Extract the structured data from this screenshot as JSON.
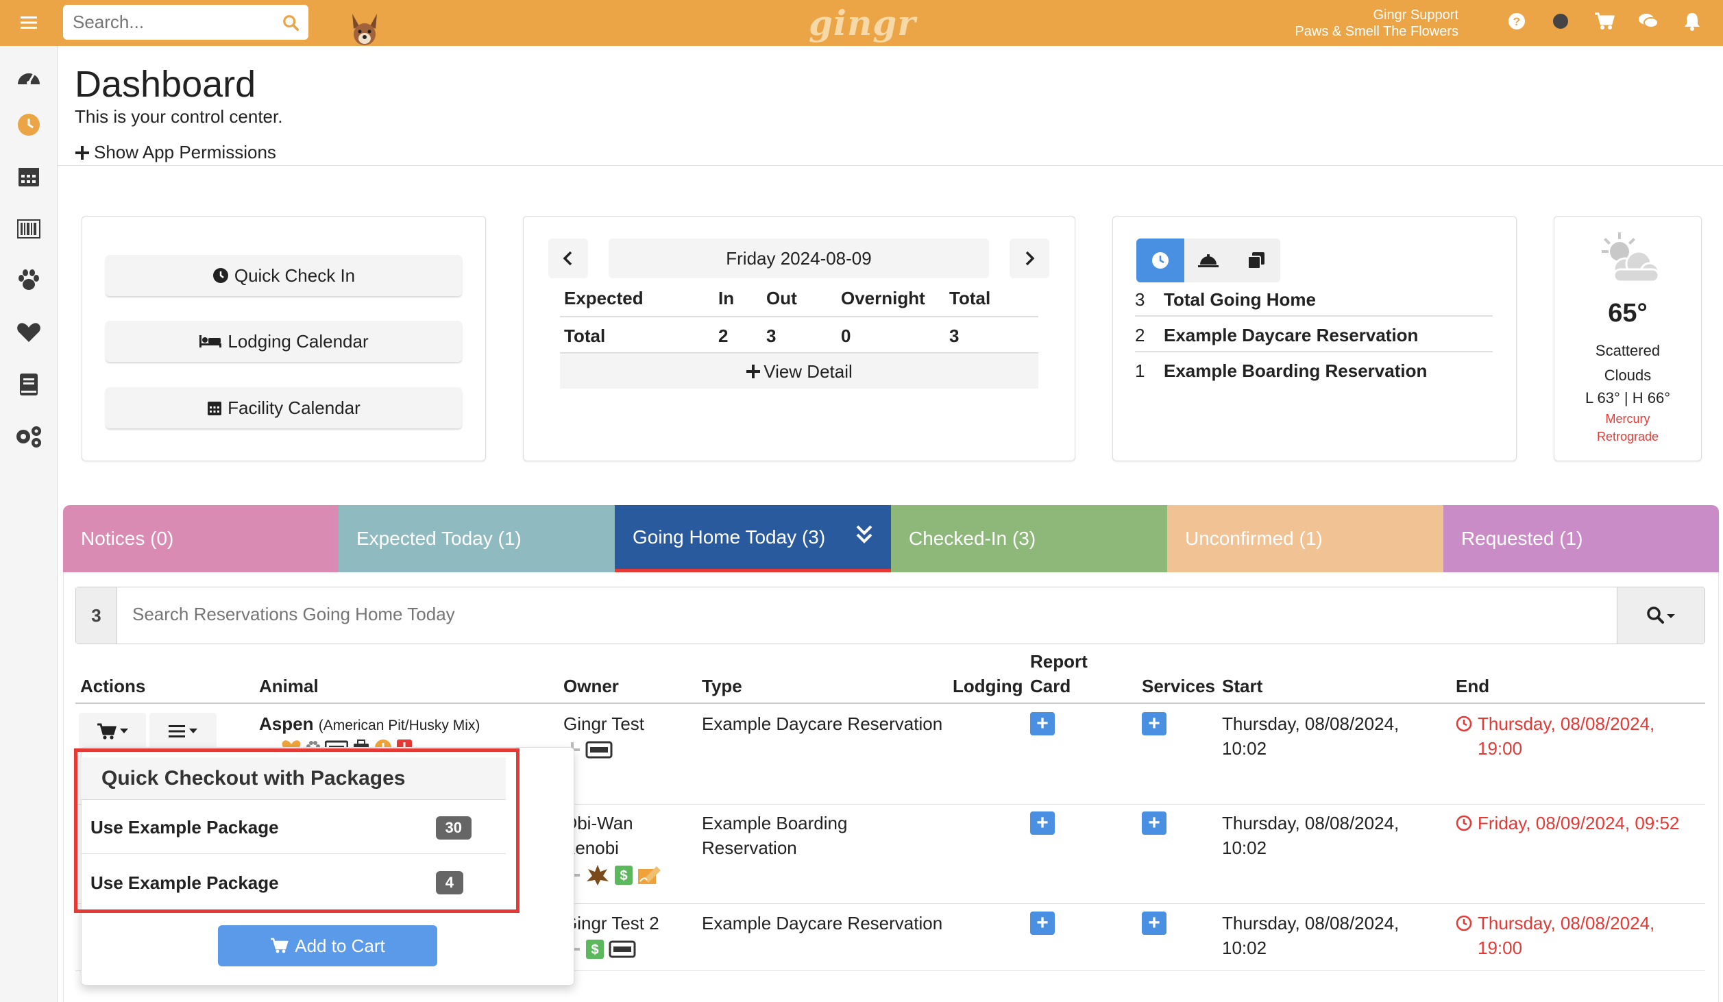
{
  "topbar": {
    "search_placeholder": "Search...",
    "logo_text": "gingr",
    "user_name": "Gingr Support",
    "user_location": "Paws & Smell The Flowers",
    "colors": {
      "bar": "#eba446"
    }
  },
  "header": {
    "title": "Dashboard",
    "subtitle": "This is your control center.",
    "permissions_link": "Show App Permissions"
  },
  "quick_actions": {
    "check_in": "Quick Check In",
    "lodging": "Lodging Calendar",
    "facility": "Facility Calendar"
  },
  "summary": {
    "date": "Friday 2024-08-09",
    "headers": [
      "Expected",
      "In",
      "Out",
      "Overnight",
      "Total"
    ],
    "row": [
      "Total",
      "2",
      "3",
      "0",
      "3"
    ],
    "view_detail": "View Detail"
  },
  "going_home": {
    "rows": [
      {
        "num": "3",
        "label": "Total Going Home"
      },
      {
        "num": "2",
        "label": "Example Daycare Reservation"
      },
      {
        "num": "1",
        "label": "Example Boarding Reservation"
      }
    ]
  },
  "weather": {
    "temp": "65°",
    "desc_line1": "Scattered",
    "desc_line2": "Clouds",
    "range": "L 63° | H 66°",
    "alert_line1": "Mercury",
    "alert_line2": "Retrograde"
  },
  "tabs": [
    {
      "label": "Notices (0)",
      "color": "#d98bb4"
    },
    {
      "label": "Expected Today (1)",
      "color": "#8fbac0"
    },
    {
      "label": "Going Home Today (3)",
      "color": "#2a5a9e",
      "active": true
    },
    {
      "label": "Checked-In (3)",
      "color": "#8db87a"
    },
    {
      "label": "Unconfirmed (1)",
      "color": "#f0c294"
    },
    {
      "label": "Requested (1)",
      "color": "#c98cc7"
    }
  ],
  "res_search": {
    "count": "3",
    "placeholder": "Search Reservations Going Home Today"
  },
  "table": {
    "headers": {
      "actions": "Actions",
      "animal": "Animal",
      "owner": "Owner",
      "type": "Type",
      "lodging": "Lodging",
      "report_1": "Report",
      "report_2": "Card",
      "services": "Services",
      "start": "Start",
      "end": "End"
    },
    "rows": [
      {
        "animal": "Aspen",
        "breed": "(American Pit/Husky Mix)",
        "owner": "Gingr Test",
        "type_1": "Example Daycare Reservation",
        "type_2": "",
        "start_1": "Thursday, 08/08/2024,",
        "start_2": "10:02",
        "end_1": "Thursday, 08/08/2024,",
        "end_2": "19:00"
      },
      {
        "owner_1": "Obi-Wan",
        "owner_2": "Kenobi",
        "type_1": "Example Boarding",
        "type_2": "Reservation",
        "start_1": "Thursday, 08/08/2024,",
        "start_2": "10:02",
        "end_1": "Friday, 08/09/2024, 09:52"
      },
      {
        "owner": "Gingr Test 2",
        "type_1": "Example Daycare Reservation",
        "start_1": "Thursday, 08/08/2024,",
        "start_2": "10:02",
        "end_1": "Thursday, 08/08/2024,",
        "end_2": "19:00"
      }
    ]
  },
  "dropdown": {
    "title": "Quick Checkout with Packages",
    "items": [
      {
        "label": "Use Example Package",
        "count": "30"
      },
      {
        "label": "Use Example Package",
        "count": "4"
      }
    ],
    "add_to_cart": "Add to Cart"
  }
}
